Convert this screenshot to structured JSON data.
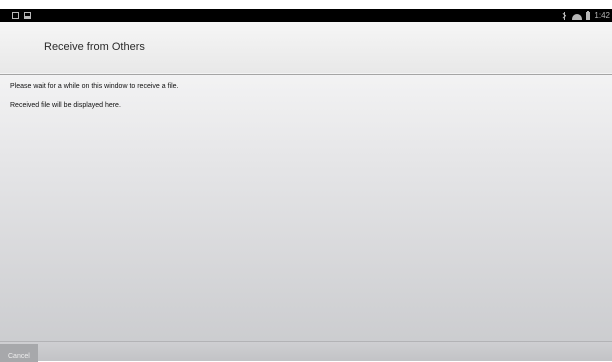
{
  "status_bar": {
    "left_icons": [
      "notification-icon",
      "image-icon"
    ],
    "right_icons": [
      "bluetooth-icon",
      "wifi-icon",
      "battery-icon"
    ],
    "time": "1:42"
  },
  "action_bar": {
    "title": "Receive from Others"
  },
  "content": {
    "message": "Please wait for a while on this window to receive a file.",
    "received_info": "Received file will be displayed here."
  },
  "bottom_bar": {
    "cancel_label": "Cancel"
  }
}
